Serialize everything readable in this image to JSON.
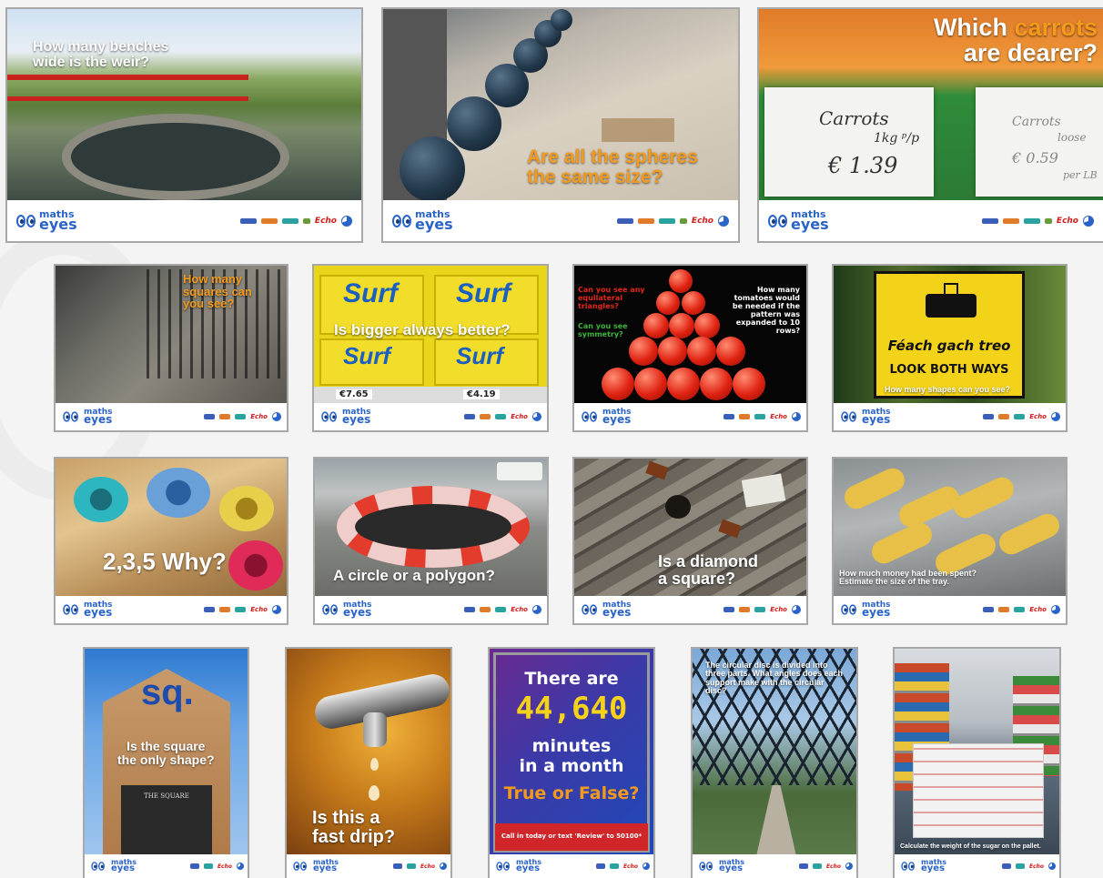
{
  "branding": {
    "logo_word_top": "maths",
    "logo_word_bottom": "eyes",
    "sponsor_echo": "Echo"
  },
  "posters": {
    "p1": {
      "caption": "How many benches wide is the weir?"
    },
    "p2": {
      "caption_line1": "Are all the spheres",
      "caption_line2": "the same size?"
    },
    "p3": {
      "caption_part1": "Which ",
      "caption_highlight": "carrots",
      "caption_part2": "are dearer?",
      "sign_left_1": "Carrots",
      "sign_left_2": "1kg ᵖ/p",
      "sign_left_3": "€ 1.39",
      "sign_right_1": "Carrots",
      "sign_right_2": "loose",
      "sign_right_3": "€ 0.59",
      "sign_right_4": "per LB"
    },
    "p4": {
      "caption": "How many squares can you see?"
    },
    "p5": {
      "caption": "Is bigger always better?",
      "brand": "Surf",
      "price_1": "€7.65",
      "price_2": "€4.19"
    },
    "p6": {
      "q1": "Can you see any equilateral triangles?",
      "q2": "Can you see symmetry?",
      "q3": "How many tomatoes would be needed if the pattern was expanded to 10 rows?"
    },
    "p7": {
      "sign_irish": "Féach gach treo",
      "sign_english": "LOOK BOTH WAYS",
      "caption": "How many shapes can you see?"
    },
    "p8": {
      "caption": "2,3,5 Why?"
    },
    "p9": {
      "caption": "A circle or a polygon?"
    },
    "p10": {
      "caption_line1": "Is a diamond",
      "caption_line2": "a square?"
    },
    "p11": {
      "caption_line1": "How much money had been spent?",
      "caption_line2": "Estimate the size of the tray."
    },
    "p12": {
      "sign": "sq.",
      "caption_line1": "Is the square",
      "caption_line2": "the only shape?",
      "building_sign": "THE SQUARE"
    },
    "p13": {
      "caption_line1": "Is this a",
      "caption_line2": "fast drip?"
    },
    "p14": {
      "line1": "There are",
      "number": "44,640",
      "line3": "minutes",
      "line4": "in a month",
      "line5": "True or False?",
      "footer": "Call in today or text 'Review' to 50100*"
    },
    "p15": {
      "caption": "The circular disc is divided into three parts. What angles does each support make with the circular disc?"
    },
    "p16": {
      "caption": "Calculate the weight of the sugar on the pallet."
    }
  },
  "colors": {
    "accent_orange": "#f39a1c",
    "logo_blue": "#2a64c8",
    "echo_red": "#d21b1b"
  }
}
